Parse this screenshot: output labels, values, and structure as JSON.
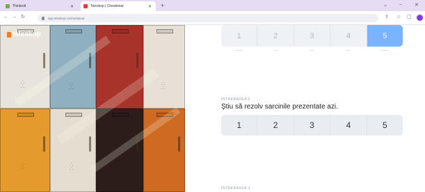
{
  "browser": {
    "tabs": [
      {
        "title": "Thinkrolt",
        "favicon_color": "#7aa84e"
      },
      {
        "title": "Teleskop | Chestionar",
        "favicon_color": "#e53935"
      }
    ],
    "new_tab": "+",
    "url": "app.teleskop.ro/chestionar",
    "window_controls": [
      "⌄",
      "–",
      "✕"
    ]
  },
  "brand": {
    "name": "teleskop",
    "accent": "#ff7a1a"
  },
  "question_scale_top": {
    "options": [
      "1",
      "2",
      "3",
      "4",
      "5"
    ],
    "selected": "5",
    "selected_color": "#7ab3ff"
  },
  "question2": {
    "label": "INTREBAREA 2",
    "text": "Știu să rezolv sarcinile prezentate azi.",
    "options": [
      "1",
      "2",
      "3",
      "4",
      "5"
    ]
  },
  "question3": {
    "label": "INTREBAREA 3"
  }
}
